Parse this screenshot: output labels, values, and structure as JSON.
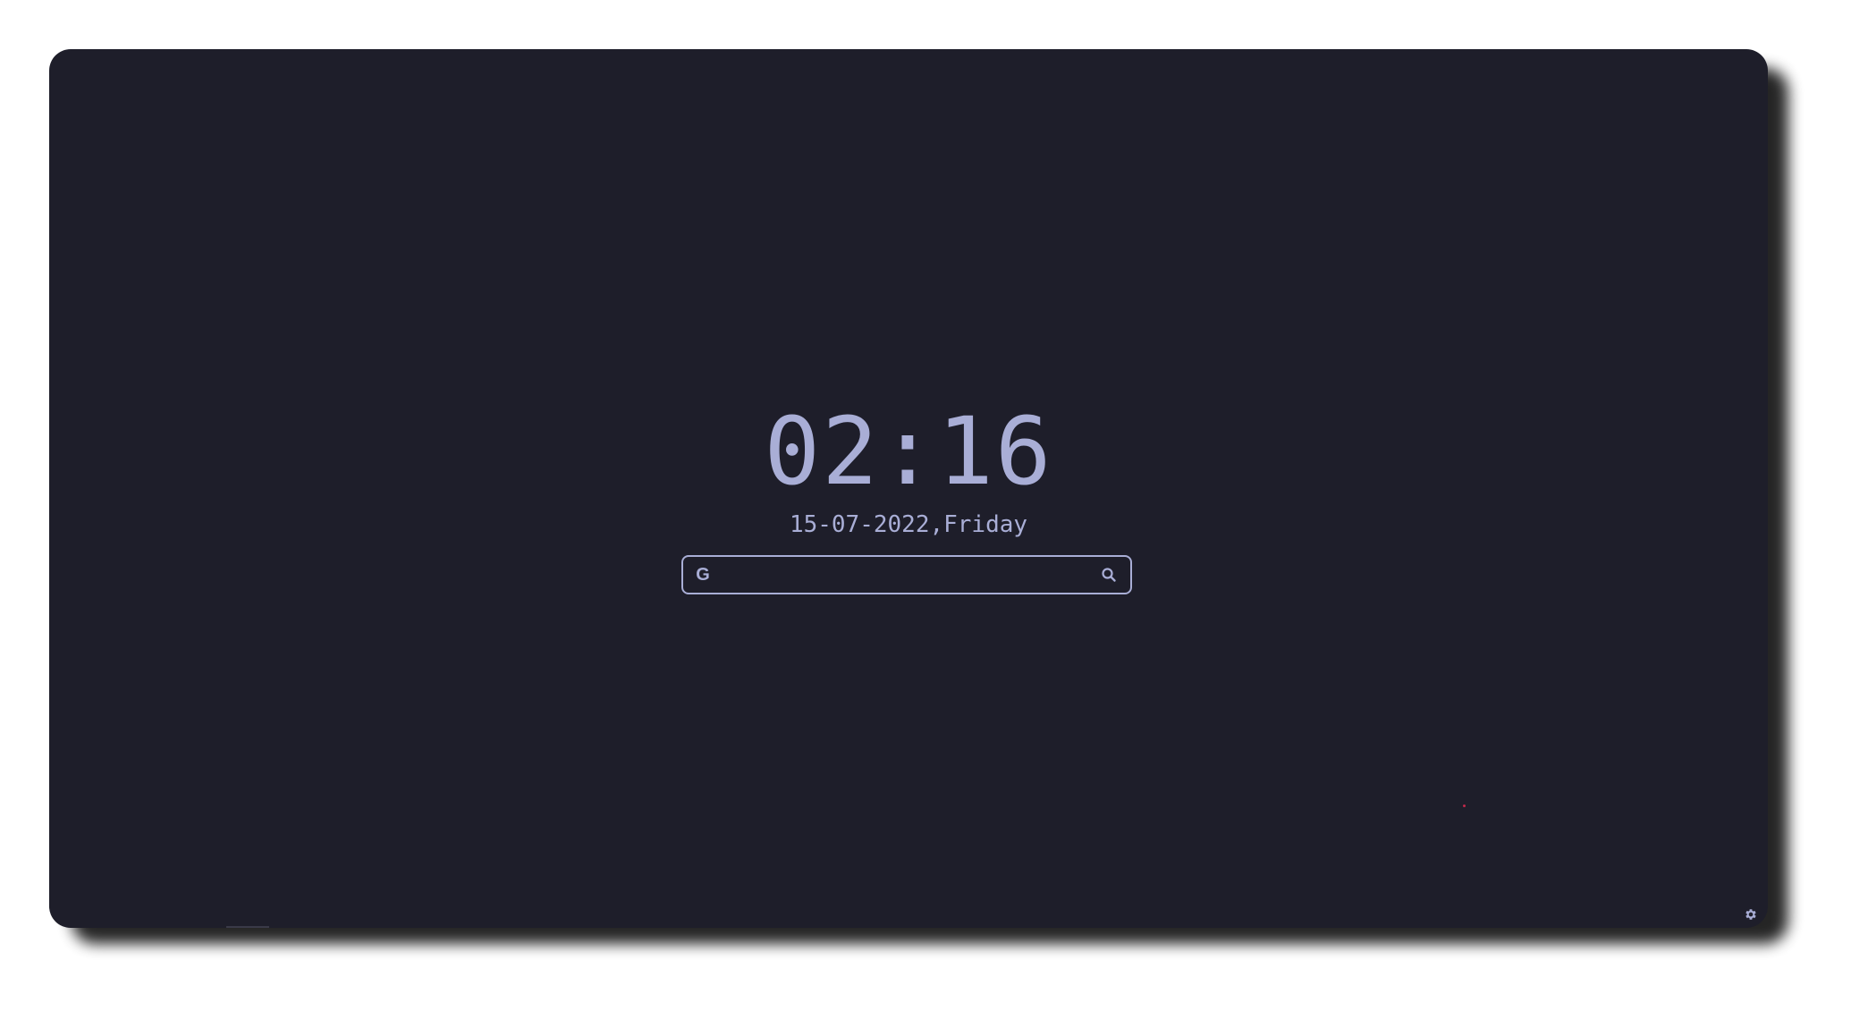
{
  "clock": {
    "time": "02:16"
  },
  "date": {
    "text": "15-07-2022,Friday"
  },
  "search": {
    "engine_icon": "google-icon",
    "engine_letter": "G",
    "value": "",
    "placeholder": "",
    "button_icon": "search-icon"
  },
  "footer": {
    "settings_icon": "gear-icon"
  },
  "colors": {
    "background": "#1e1e2a",
    "foreground": "#a9aed6",
    "accent_dot": "#c0284a"
  }
}
